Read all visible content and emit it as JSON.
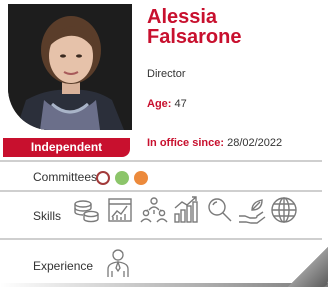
{
  "profile": {
    "first_name": "Alessia",
    "last_name": "Falsarone",
    "role": "Director",
    "age_label": "Age:",
    "age_value": "47",
    "office_label": "In office since:",
    "office_value": "28/02/2022",
    "badge": "Independent"
  },
  "sections": {
    "committees_label": "Committees",
    "skills_label": "Skills",
    "experience_label": "Experience"
  },
  "committees": [
    {
      "icon": "committee-outline-icon",
      "color": "#a23a3a"
    },
    {
      "icon": "committee-green-icon",
      "color": "#8cc56a"
    },
    {
      "icon": "committee-orange-icon",
      "color": "#ec8a3c"
    }
  ],
  "skills": [
    "finance-coins-icon",
    "reporting-chart-icon",
    "organization-people-icon",
    "growth-bars-icon",
    "analysis-magnifier-icon",
    "sustainability-hand-leaf-icon",
    "international-globe-icon"
  ],
  "experience": [
    "executive-person-icon"
  ],
  "colors": {
    "accent": "#c8102e",
    "text": "#333333",
    "divider": "#cfcfcf",
    "icon_stroke": "#7a7a7a"
  }
}
